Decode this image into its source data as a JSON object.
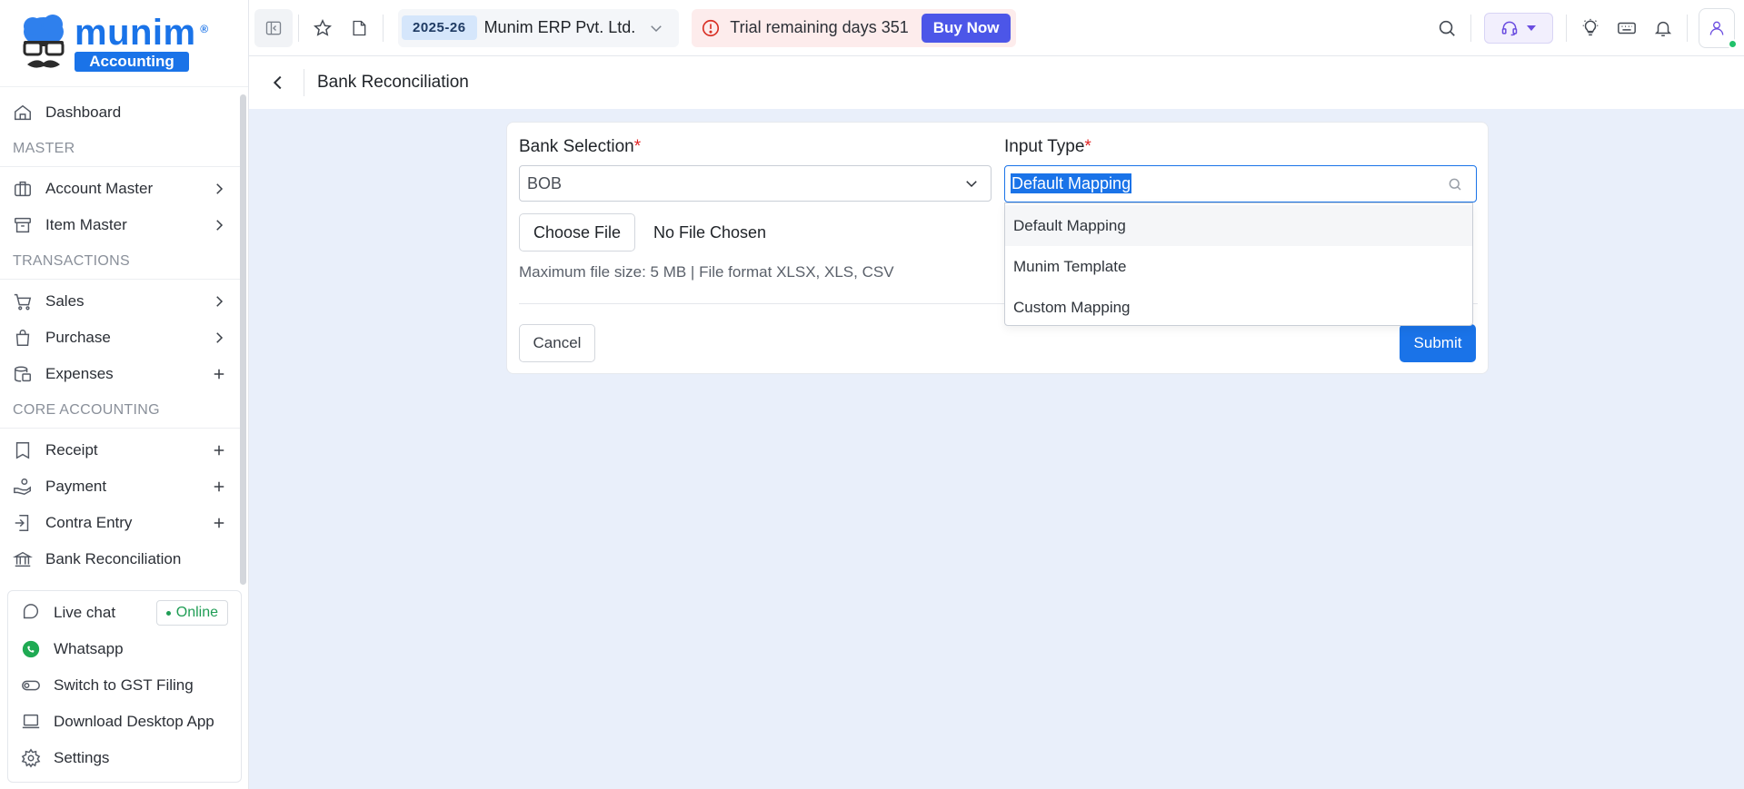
{
  "brand": {
    "name": "munim",
    "registered": "®",
    "sub": "Accounting"
  },
  "sidebar": {
    "dashboard": "Dashboard",
    "sections": {
      "master": "MASTER",
      "transactions": "TRANSACTIONS",
      "core": "CORE ACCOUNTING"
    },
    "items": {
      "account_master": "Account Master",
      "item_master": "Item Master",
      "sales": "Sales",
      "purchase": "Purchase",
      "expenses": "Expenses",
      "receipt": "Receipt",
      "payment": "Payment",
      "contra_entry": "Contra Entry",
      "bank_reconciliation": "Bank Reconciliation"
    },
    "support": {
      "live_chat": "Live chat",
      "online": "Online",
      "whatsapp": "Whatsapp",
      "gst": "Switch to GST Filing",
      "download": "Download Desktop App",
      "settings": "Settings"
    }
  },
  "topbar": {
    "year": "2025-26",
    "company": "Munim ERP Pvt. Ltd.",
    "trial_text": "Trial remaining days 351",
    "buy_now": "Buy Now"
  },
  "page": {
    "title": "Bank Reconciliation"
  },
  "form": {
    "bank_label": "Bank Selection",
    "bank_value": "BOB",
    "required_mark": "*",
    "input_type_label": "Input Type",
    "input_type_value": "Default Mapping",
    "input_type_options": [
      "Default Mapping",
      "Munim Template",
      "Custom Mapping"
    ],
    "choose_file": "Choose File",
    "no_file": "No File Chosen",
    "hint": "Maximum file size: 5 MB | File format XLSX, XLS, CSV",
    "cancel": "Cancel",
    "submit": "Submit"
  },
  "colors": {
    "accent": "#1a73e8",
    "buy": "#4c56e8",
    "online": "#1f9d55",
    "required": "#e02424"
  }
}
